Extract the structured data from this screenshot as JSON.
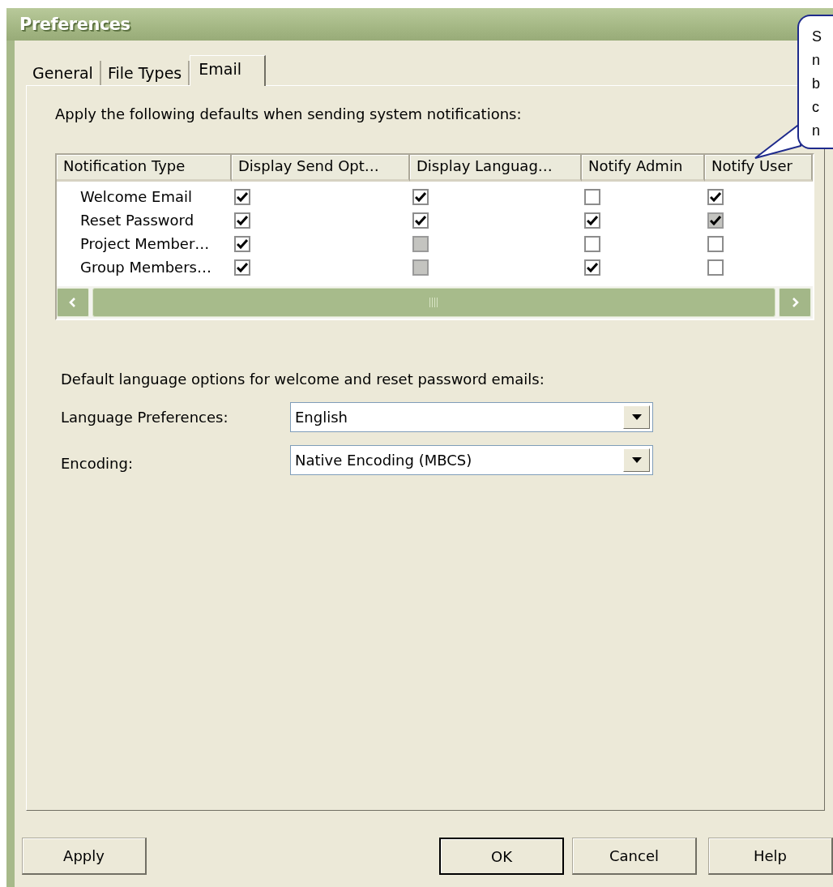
{
  "window": {
    "title": "Preferences"
  },
  "tabs": [
    {
      "label": "General",
      "selected": false
    },
    {
      "label": "File Types",
      "selected": false
    },
    {
      "label": "Email",
      "selected": true
    }
  ],
  "intro": "Apply the following defaults when sending system notifications:",
  "table": {
    "columns": [
      "Notification Type",
      "Display Send Opt…",
      "Display Languag…",
      "Notify Admin",
      "Notify User"
    ],
    "rows": [
      {
        "name": "Welcome Email",
        "cells": [
          {
            "checked": true,
            "disabled": false
          },
          {
            "checked": true,
            "disabled": false
          },
          {
            "checked": false,
            "disabled": false
          },
          {
            "checked": true,
            "disabled": false
          }
        ]
      },
      {
        "name": "Reset Password",
        "cells": [
          {
            "checked": true,
            "disabled": false
          },
          {
            "checked": true,
            "disabled": false
          },
          {
            "checked": true,
            "disabled": false
          },
          {
            "checked": true,
            "disabled": true
          }
        ]
      },
      {
        "name": "Project Member…",
        "cells": [
          {
            "checked": true,
            "disabled": false
          },
          {
            "checked": false,
            "disabled": true
          },
          {
            "checked": false,
            "disabled": false
          },
          {
            "checked": false,
            "disabled": false
          }
        ]
      },
      {
        "name": "Group Members…",
        "cells": [
          {
            "checked": true,
            "disabled": false
          },
          {
            "checked": false,
            "disabled": true
          },
          {
            "checked": true,
            "disabled": false
          },
          {
            "checked": false,
            "disabled": false
          }
        ]
      }
    ]
  },
  "language_section": {
    "heading": "Default language options for welcome and reset password emails:",
    "fields": [
      {
        "label": "Language Preferences:",
        "value": "English"
      },
      {
        "label": "Encoding:",
        "value": "Native Encoding (MBCS)"
      }
    ]
  },
  "buttons": [
    {
      "label": "Apply",
      "default": false
    },
    {
      "label": "OK",
      "default": true
    },
    {
      "label": "Cancel",
      "default": false
    },
    {
      "label": "Help",
      "default": false
    }
  ],
  "callout": {
    "lines": [
      "S",
      "n",
      "b",
      "c",
      "n"
    ]
  }
}
